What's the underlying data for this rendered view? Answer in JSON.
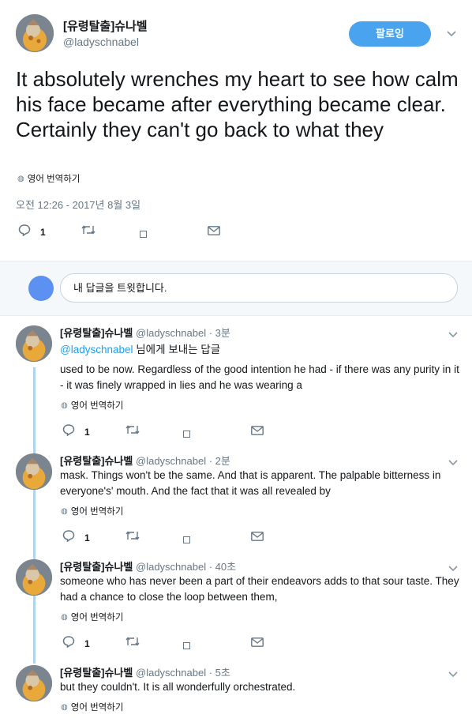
{
  "main_tweet": {
    "name": "[유령탈출]슈나벨",
    "handle": "@ladyschnabel",
    "follow_label": "팔로잉",
    "text": "It absolutely wrenches my heart to see how calm his face became after everything became clear. Certainly they can't go back to what they",
    "translate_label": "영어 번역하기",
    "timestamp": "오전 12:26 - 2017년 8월 3일",
    "reply_count": "1"
  },
  "reply_box": {
    "placeholder": "내 답글을 트윗합니다."
  },
  "replies": [
    {
      "name": "[유령탈출]슈나벨",
      "handle": "@ladyschnabel",
      "time": "· 3분",
      "replying_to_handle": "@ladyschnabel",
      "replying_to_suffix": " 님에게 보내는 답글",
      "text": "used to be now. Regardless of the good intention he had - if there was any purity in it - it was finely wrapped in lies and he was wearing a",
      "translate_label": "영어 번역하기",
      "reply_count": "1"
    },
    {
      "name": "[유령탈출]슈나벨",
      "handle": "@ladyschnabel",
      "time": "· 2분",
      "text": "mask. Things won't be the same. And that is apparent. The palpable bitterness in everyone's' mouth. And the fact that it was all revealed by",
      "translate_label": "영어 번역하기",
      "reply_count": "1"
    },
    {
      "name": "[유령탈출]슈나벨",
      "handle": "@ladyschnabel",
      "time": "· 40초",
      "text": "someone who has never been a part of their endeavors adds to that sour taste. They had a chance to close the loop between them,",
      "translate_label": "영어 번역하기",
      "reply_count": "1"
    },
    {
      "name": "[유령탈출]슈나벨",
      "handle": "@ladyschnabel",
      "time": "· 5초",
      "text": "but they couldn't. It is all wonderfully orchestrated.",
      "translate_label": "영어 번역하기"
    }
  ],
  "colors": {
    "accent": "#1da1f2",
    "follow_button": "#4aa3ee",
    "thread_line": "#aed4f0",
    "muted": "#657786"
  },
  "icons": [
    "avatar-image",
    "chevron-down-icon",
    "globe-icon",
    "reply-icon",
    "retweet-icon",
    "like-icon",
    "message-icon"
  ]
}
